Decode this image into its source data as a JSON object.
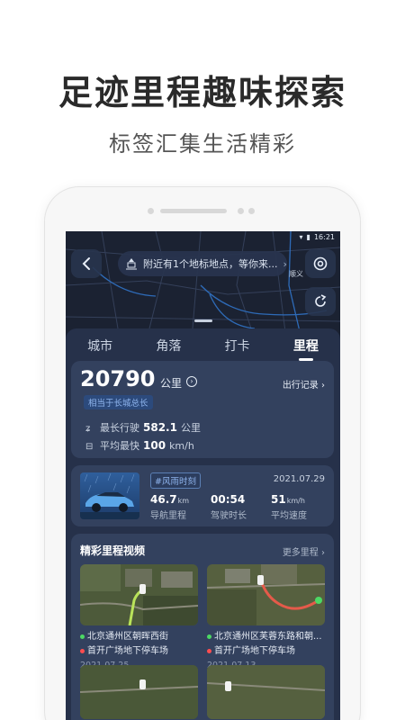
{
  "promo": {
    "title": "足迹里程趣味探索",
    "subtitle": "标签汇集生活精彩"
  },
  "status_bar": {
    "time": "16:21"
  },
  "map": {
    "banner_text": "附近有1个地标地点，等你来...",
    "place_label": "顺义"
  },
  "tabs": [
    {
      "label": "城市",
      "active": false
    },
    {
      "label": "角落",
      "active": false
    },
    {
      "label": "打卡",
      "active": false
    },
    {
      "label": "里程",
      "active": true
    }
  ],
  "mileage": {
    "total": "20790",
    "unit": "公里",
    "equivalent": "相当于长城总长",
    "records_link": "出行记录",
    "longest_label": "最长行驶",
    "longest_value": "582.1",
    "longest_unit": "公里",
    "avg_label": "平均最快",
    "avg_value": "100",
    "avg_unit": "km/h"
  },
  "trip": {
    "tag": "#风雨时刻",
    "date": "2021.07.29",
    "stats": [
      {
        "value": "46.7",
        "unit": "km",
        "label": "导航里程"
      },
      {
        "value": "00:54",
        "unit": "",
        "label": "驾驶时长"
      },
      {
        "value": "51",
        "unit": "km/h",
        "label": "平均速度"
      }
    ]
  },
  "videos": {
    "title": "精彩里程视频",
    "more": "更多里程",
    "items": [
      {
        "from": "北京通州区朝晖西街",
        "to": "首开广场地下停车场",
        "date": "2021.07.25"
      },
      {
        "from": "北京通州区芙蓉东路和朝...",
        "to": "首开广场地下停车场",
        "date": "2021.07.13"
      }
    ]
  },
  "colors": {
    "screen_bg": "#1b2232",
    "card_bg": "#33415e",
    "accent_blue": "#8fb5ee",
    "start_dot": "#4cd964",
    "end_dot": "#ff4d4f"
  }
}
